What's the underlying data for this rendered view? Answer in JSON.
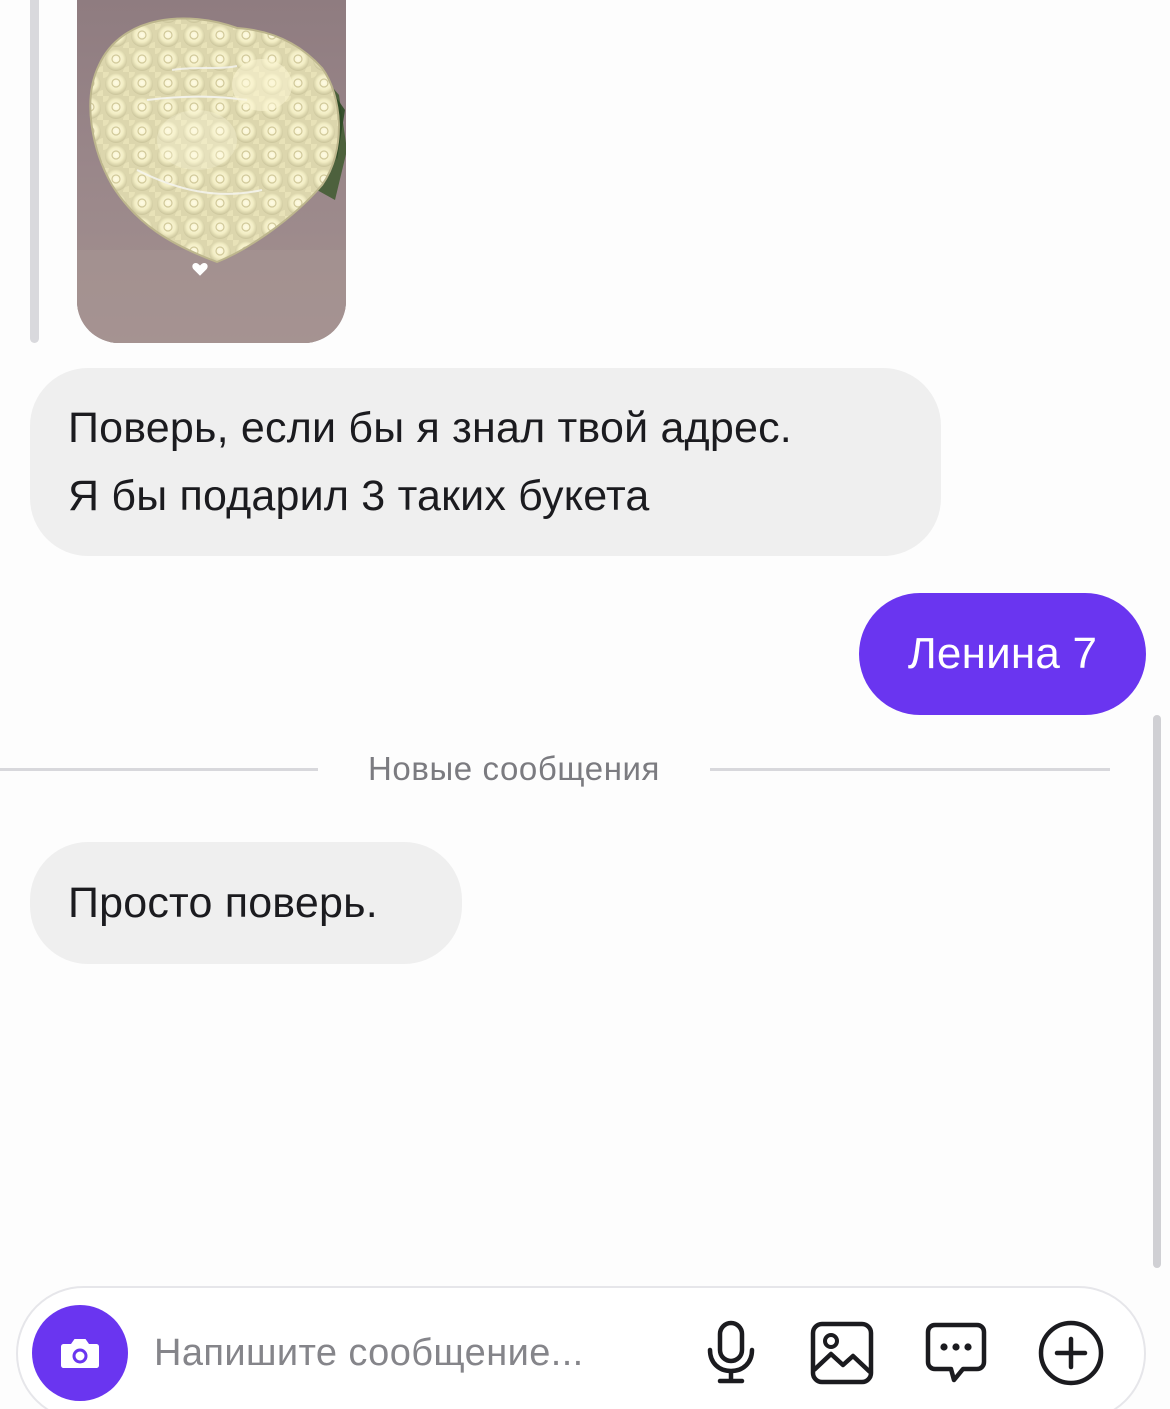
{
  "conversation": {
    "photo": {
      "subject": "white-roses-heart-bouquet",
      "like_icon": "heart-icon"
    },
    "messages": [
      {
        "direction": "incoming",
        "lines": [
          "Поверь, если бы я знал твой адрес.",
          "Я бы подарил 3 таких букета"
        ]
      },
      {
        "direction": "outgoing",
        "text": "Ленина 7"
      },
      {
        "direction": "incoming",
        "text": "Просто поверь."
      }
    ],
    "new_messages_divider": "Новые сообщения"
  },
  "composer": {
    "placeholder": "Напишите сообщение...",
    "camera_icon": "camera-icon",
    "tools": [
      "microphone-icon",
      "gallery-icon",
      "chat-bubble-icon",
      "plus-circle-icon"
    ]
  },
  "colors": {
    "accent": "#6a35f0",
    "incoming_bubble": "#efefef",
    "background": "#fdfdfd",
    "muted_text": "#7b7b80"
  }
}
